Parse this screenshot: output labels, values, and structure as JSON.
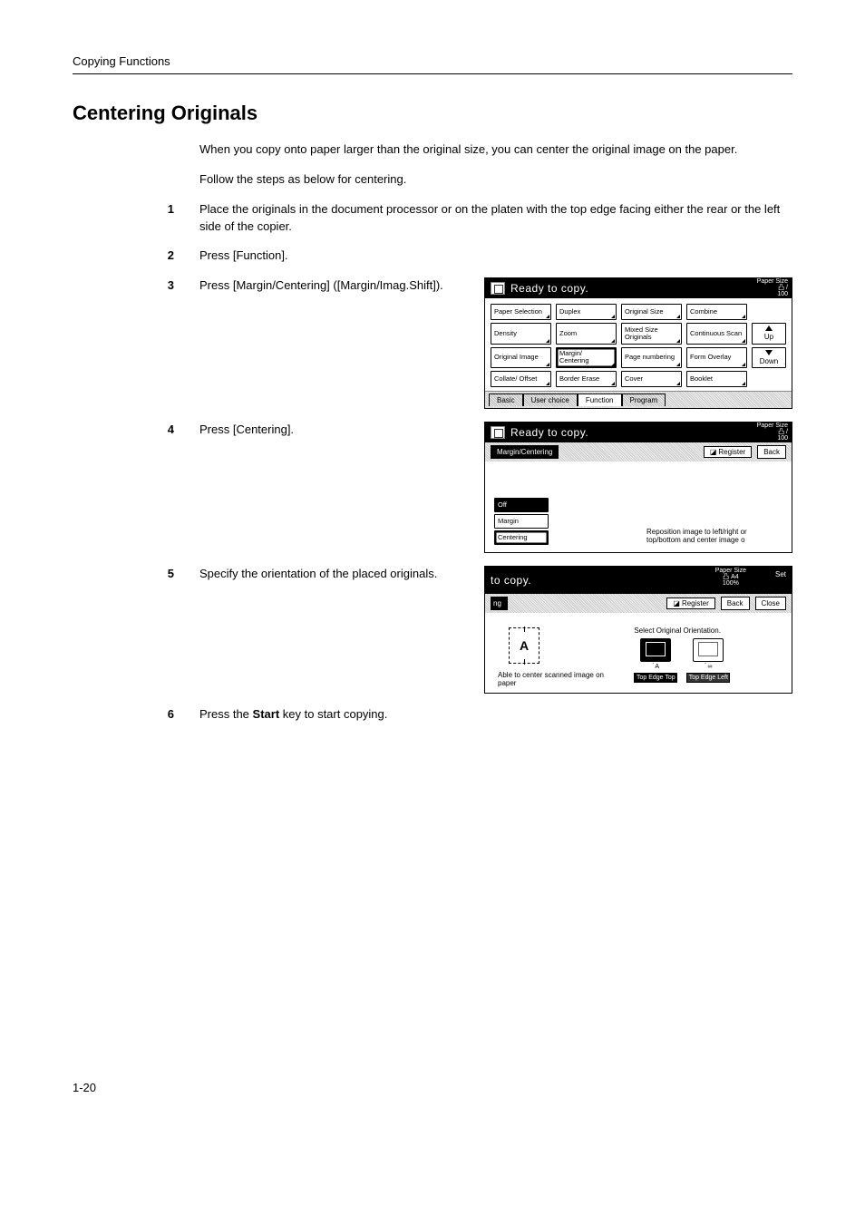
{
  "running_head": "Copying Functions",
  "heading": "Centering Originals",
  "intro": [
    "When you copy onto paper larger than the original size, you can center the original image on the paper.",
    "Follow the steps as below for centering."
  ],
  "steps": {
    "s1": "Place the originals in the document processor or on the platen with the top edge facing either the rear or the left side of the copier.",
    "s2": "Press [Function].",
    "s3": "Press [Margin/Centering] ([Margin/Imag.Shift]).",
    "s4": "Press [Centering].",
    "s5": "Specify the orientation of the placed originals.",
    "s6_pre": "Press the ",
    "s6_bold": "Start",
    "s6_post": " key to start copying."
  },
  "panel1": {
    "title": "Ready to copy.",
    "paper_size_label": "Paper Size",
    "paper_size_sub": "100",
    "buttons": {
      "paper_selection": "Paper Selection",
      "duplex": "Duplex",
      "original_size": "Original Size",
      "combine": "Combine",
      "density": "Density",
      "zoom": "Zoom",
      "mixed_size": "Mixed Size Originals",
      "continuous_scan": "Continuous Scan",
      "up": "Up",
      "original_image": "Original Image",
      "margin_centering": "Margin/ Centering",
      "page_numbering": "Page numbering",
      "form_overlay": "Form Overlay",
      "down": "Down",
      "collate_offset": "Collate/ Offset",
      "border_erase": "Border Erase",
      "cover": "Cover",
      "booklet": "Booklet"
    },
    "tabs": {
      "basic": "Basic",
      "user_choice": "User choice",
      "function": "Function",
      "program": "Program"
    }
  },
  "panel2": {
    "title": "Ready to copy.",
    "paper_size_label": "Paper Size",
    "paper_size_sub": "100",
    "sub_tab": "Margin/Centering",
    "register": "Register",
    "back": "Back",
    "off": "Off",
    "margin": "Margin",
    "centering": "Centering",
    "hint": "Reposition image to left/right or top/bottom and center image o"
  },
  "panel3": {
    "title": "to copy.",
    "paper_size_label": "Paper Size",
    "paper_size_val": "A4",
    "paper_size_pct": "100%",
    "set": "Set",
    "sub_tab_suffix": "ng",
    "register": "Register",
    "back": "Back",
    "close": "Close",
    "caption": "Able to center scanned image on paper",
    "orient_label": "Select Original Orientation.",
    "top_edge_top": "Top Edge Top",
    "top_edge_left": "Top Edge Left",
    "glyph": "A"
  },
  "page_number": "1-20"
}
